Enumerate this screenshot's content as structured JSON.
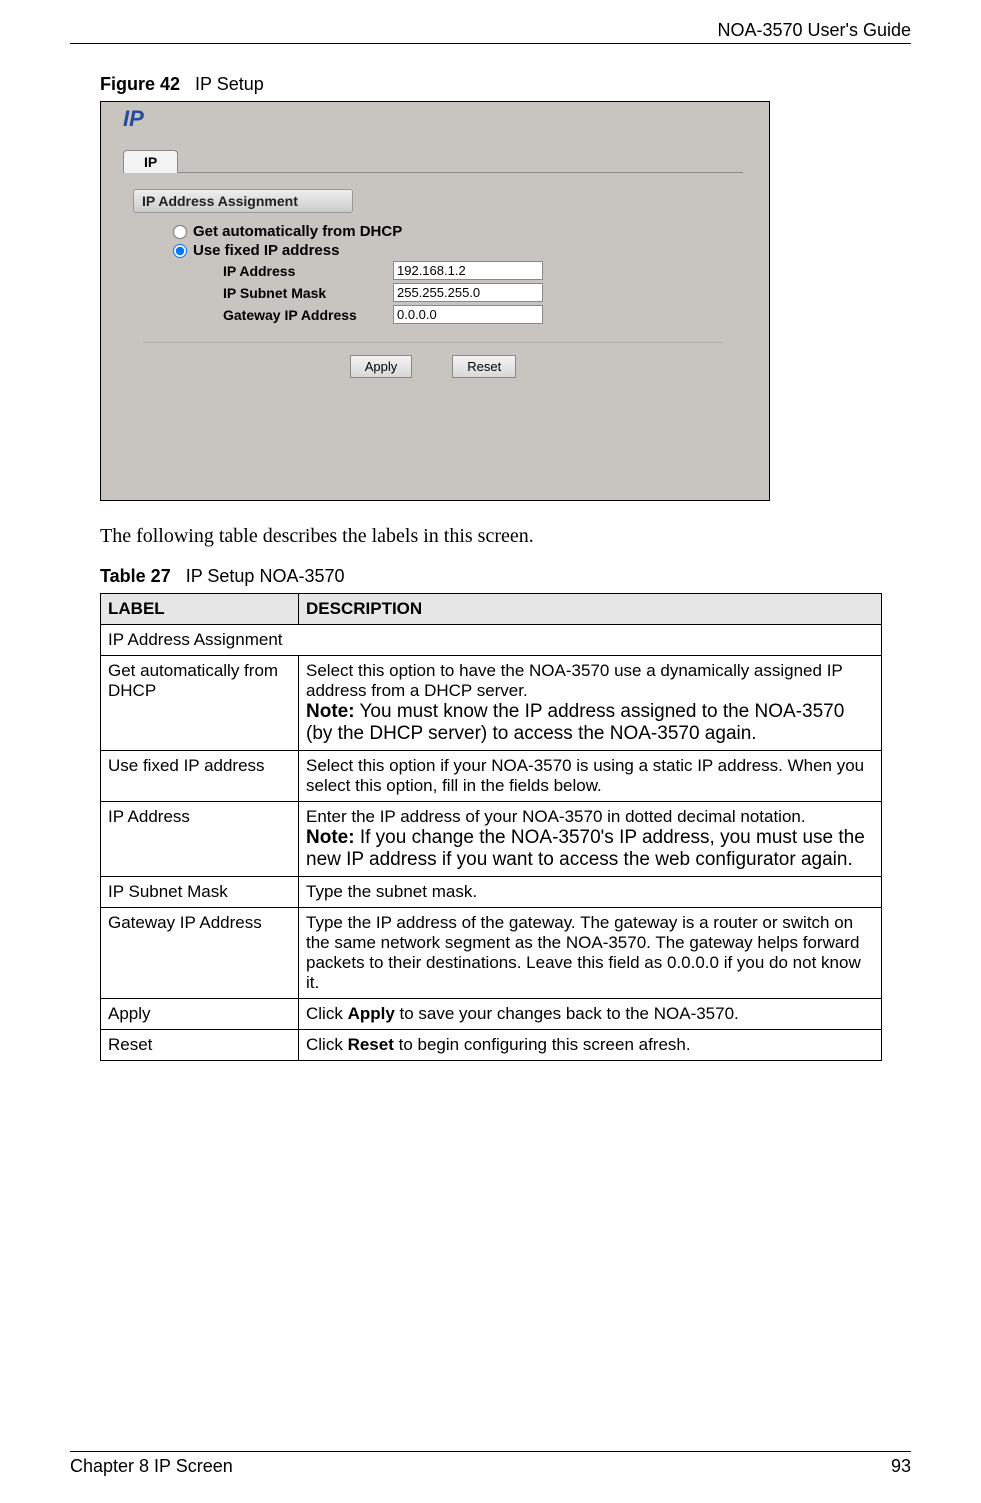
{
  "header": {
    "guide_title": "NOA-3570 User's Guide"
  },
  "figure": {
    "label": "Figure 42",
    "title": "IP Setup",
    "screen_title": "IP",
    "tab_label": "IP",
    "group_label": "IP Address Assignment",
    "radio_dhcp": "Get automatically from DHCP",
    "radio_fixed": "Use fixed IP address",
    "ip_label": "IP Address",
    "ip_value": "192.168.1.2",
    "subnet_label": "IP Subnet Mask",
    "subnet_value": "255.255.255.0",
    "gateway_label": "Gateway IP Address",
    "gateway_value": "0.0.0.0",
    "apply_btn": "Apply",
    "reset_btn": "Reset"
  },
  "para1": "The following table describes the labels in this screen.",
  "table": {
    "label": "Table 27",
    "title": "IP Setup NOA-3570",
    "col1": "LABEL",
    "col2": "DESCRIPTION",
    "rows": {
      "section_header": "IP Address Assignment",
      "dhcp_label": "Get automatically from DHCP",
      "dhcp_desc1": "Select this option to have the NOA-3570 use a dynamically assigned IP address from a DHCP server.",
      "dhcp_note_b": "Note:",
      "dhcp_note": " You must know the IP address assigned to the NOA-3570 (by the DHCP server) to access the NOA-3570 again.",
      "fixed_label": "Use fixed IP address",
      "fixed_desc": "Select this option if your NOA-3570 is using a static IP address. When you select this option, fill in the fields below.",
      "ip_label": "IP Address",
      "ip_desc1": "Enter the IP address of your NOA-3570 in dotted decimal notation.",
      "ip_note_b": "Note:",
      "ip_note": " If you change the NOA-3570's IP address, you must use the new IP address if you want to access the web configurator again.",
      "subnet_label": "IP Subnet Mask",
      "subnet_desc": "Type the subnet mask.",
      "gw_label": "Gateway IP Address",
      "gw_desc": "Type the IP address of the gateway. The gateway is a router or switch on the same network segment as the NOA-3570. The gateway helps forward packets to their destinations. Leave this field as 0.0.0.0 if you do not know it.",
      "apply_label": "Apply",
      "apply_desc_pre": "Click ",
      "apply_desc_b": "Apply",
      "apply_desc_post": " to save your changes back to the NOA-3570.",
      "reset_label": "Reset",
      "reset_desc_pre": "Click ",
      "reset_desc_b": "Reset",
      "reset_desc_post": " to begin configuring this screen afresh."
    }
  },
  "footer": {
    "chapter": "Chapter 8 IP Screen",
    "page": "93"
  }
}
